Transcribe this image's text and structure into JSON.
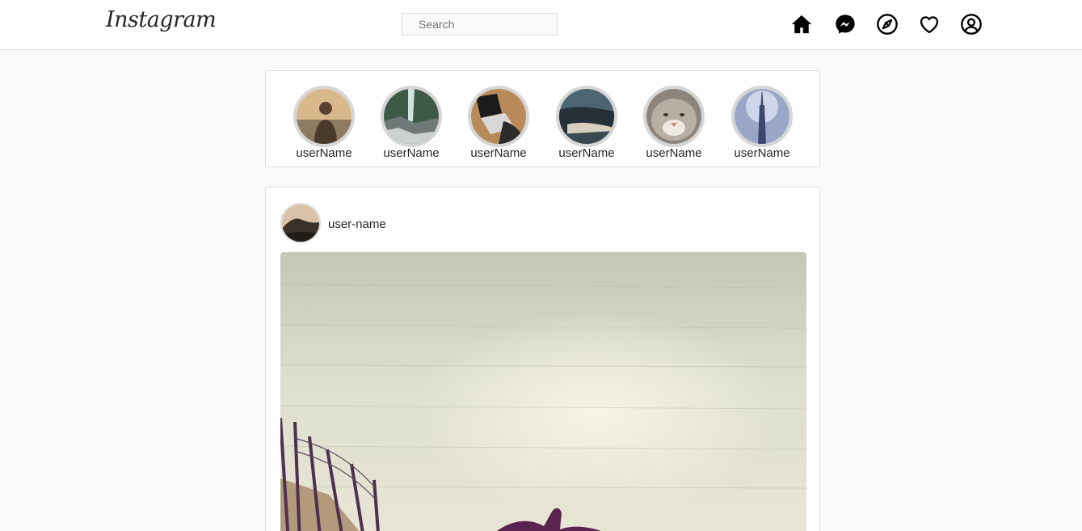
{
  "header": {
    "logo": "Instagram",
    "search": {
      "placeholder": "Search",
      "value": ""
    },
    "nav_icons": [
      "home-icon",
      "messenger-icon",
      "explore-icon",
      "heart-icon",
      "profile-icon"
    ]
  },
  "stories": [
    {
      "username": "userName",
      "icon": "story-avatar"
    },
    {
      "username": "userName",
      "icon": "story-avatar"
    },
    {
      "username": "userName",
      "icon": "story-avatar"
    },
    {
      "username": "userName",
      "icon": "story-avatar"
    },
    {
      "username": "userName",
      "icon": "story-avatar"
    },
    {
      "username": "userName",
      "icon": "story-avatar"
    }
  ],
  "post": {
    "username": "user-name",
    "image": "post-photo"
  },
  "colors": {
    "border": "#dbdbdb",
    "background": "#fafafa",
    "story_ring": "#d6d6d6",
    "text": "#262626"
  }
}
